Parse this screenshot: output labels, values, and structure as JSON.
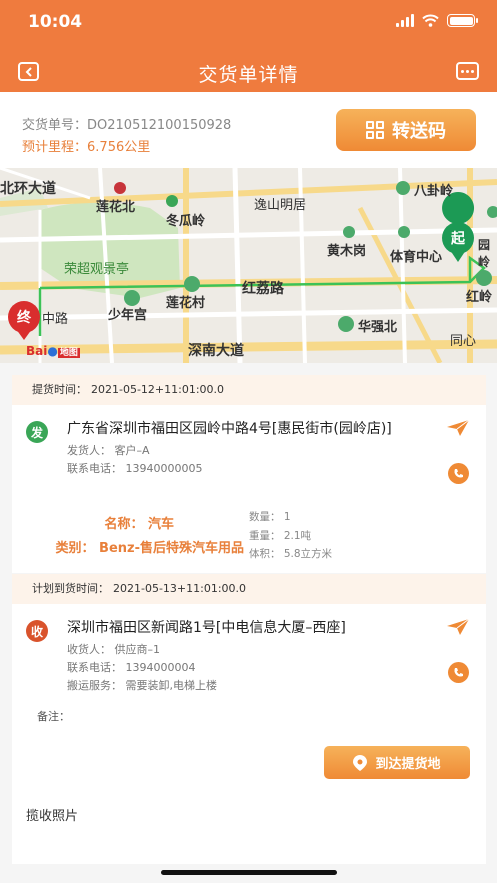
{
  "status_bar": {
    "time": "10:04"
  },
  "nav": {
    "title": "交货单详情",
    "back_icon": "back-icon",
    "more_icon": "more-icon"
  },
  "order": {
    "number_label": "交货单号：",
    "number": "DO210512100150928",
    "mileage_label": "预计里程：",
    "mileage": "6.756公里",
    "transfer_label": "转送码"
  },
  "map": {
    "labels": {
      "north_ring": "北环大道",
      "lianhua_north": "莲花北",
      "dongguan_ling": "冬瓜岭",
      "yishan": "逸山明居",
      "bagua_ling": "八卦岭",
      "huangmu_gang": "黄木岗",
      "tiyu_center": "体育中心",
      "yuanling": "园岭",
      "rongchao": "荣超观景亭",
      "lianhua_cun": "莲花村",
      "honglizhi": "红荔路",
      "hongling": "红岭",
      "shaonian_gong": "少年宫",
      "zhonglu": "中路",
      "huaqiang_north": "华强北",
      "tongxin": "同心",
      "shennan": "深南大道",
      "start_marker": "起",
      "end_marker": "终",
      "logo": "Bai",
      "logo_suffix": "地图"
    }
  },
  "pickup": {
    "time_label": "提货时间：",
    "time": "2021-05-12+11:01:00.0",
    "badge": "发",
    "address": "广东省深圳市福田区园岭中路4号[惠民街市(园岭店)]",
    "contact": "发货人：  客户–A",
    "phone": "联系电话：  13940000005"
  },
  "goods": {
    "name": "名称：  汽车",
    "category": "类别：  Benz-售后特殊汽车用品",
    "quantity": "数量：  1",
    "weight": "重量：  2.1吨",
    "volume": "体积：  5.8立方米"
  },
  "delivery": {
    "time_label": "计划到货时间：",
    "time": "2021-05-13+11:01:00.0",
    "badge": "收",
    "address": "深圳市福田区新闻路1号[中电信息大厦–西座]",
    "contact": "收货人：  供应商–1",
    "phone": "联系电话：  1394000004",
    "service": "搬运服务：  需要装卸,电梯上楼"
  },
  "remark_label": "备注：",
  "arrive_button": "到达提货地",
  "photos_label": "揽收照片",
  "colors": {
    "primary": "#ef7b3e",
    "accent": "#e8803b",
    "pickup_badge": "#3aa657",
    "delivery_badge": "#d9532c"
  }
}
